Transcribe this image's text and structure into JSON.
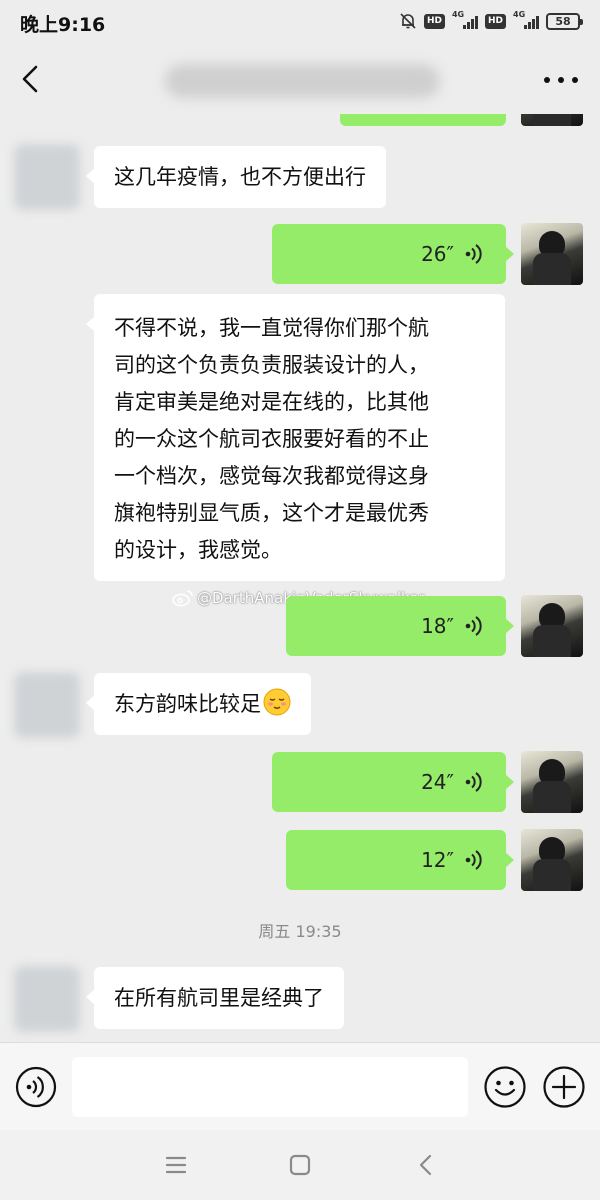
{
  "status_bar": {
    "time": "晚上9:16",
    "hd1": "HD",
    "net1": "4G",
    "hd2": "HD",
    "net2": "4G",
    "battery": "58"
  },
  "nav": {
    "back_icon": "chevron-left-icon",
    "more_icon": "more-dots-icon"
  },
  "messages": [
    {
      "from": "other",
      "type": "text",
      "text": "这几年疫情，也不方便出行"
    },
    {
      "from": "me",
      "type": "voice",
      "duration": "26″"
    },
    {
      "from": "other",
      "type": "text",
      "lines": [
        "不得不说，我一直觉得你们那个航",
        "司的这个负责负责服装设计的人，",
        "肯定审美是绝对是在线的，比其他",
        "的一众这个航司衣服要好看的不止",
        "一个档次，感觉每次我都觉得这身",
        "旗袍特别显气质，这个才是最优秀",
        "的设计，我感觉。"
      ]
    },
    {
      "from": "me",
      "type": "voice",
      "duration": "18″"
    },
    {
      "from": "other",
      "type": "text",
      "text": "东方韵味比较足",
      "emoji": "shy-smile-emoji"
    },
    {
      "from": "me",
      "type": "voice",
      "duration": "24″"
    },
    {
      "from": "me",
      "type": "voice",
      "duration": "12″"
    },
    {
      "from": "other",
      "type": "text",
      "text": "在所有航司里是经典了"
    }
  ],
  "watermark": "@DarthAnakinVaderSkywalker",
  "time_divider": "周五 19:35",
  "input_bar": {
    "value": "",
    "icons": [
      "voice-input-icon",
      "emoji-icon",
      "plus-icon"
    ]
  },
  "system_nav": {
    "icons": [
      "menu-icon",
      "home-icon",
      "back-icon"
    ]
  },
  "colors": {
    "background": "#ededed",
    "bubble_out": "#95ec69",
    "bubble_in": "#ffffff"
  }
}
